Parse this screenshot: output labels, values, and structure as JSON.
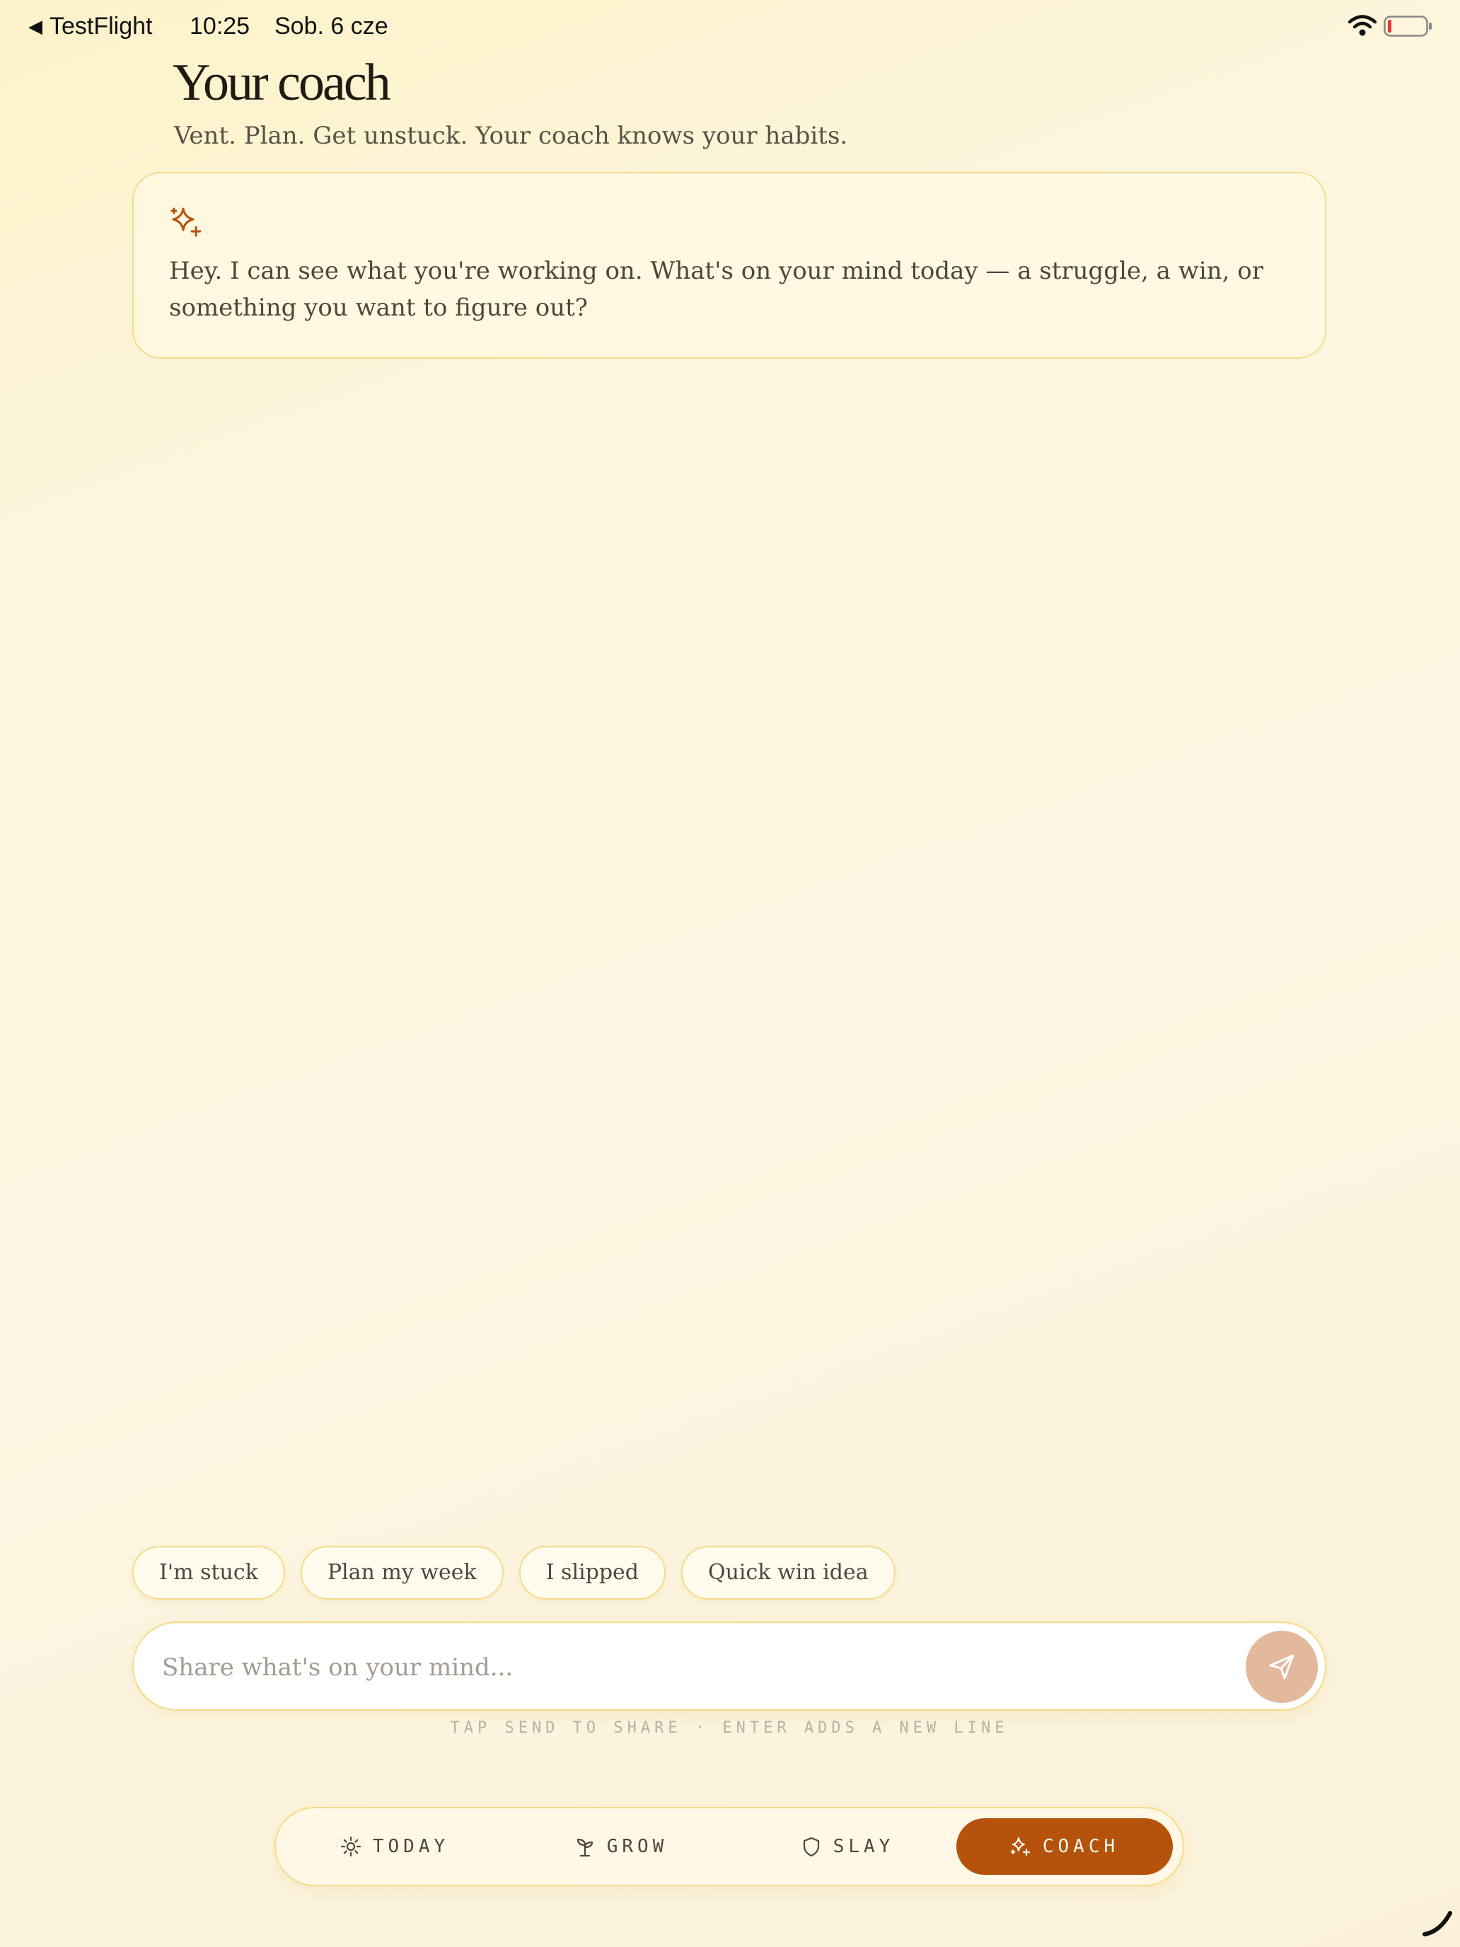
{
  "status_bar": {
    "back_app": "TestFlight",
    "time": "10:25",
    "date": "Sob. 6 cze",
    "icons": [
      "back-triangle-icon",
      "wifi-icon",
      "battery-low-icon"
    ]
  },
  "header": {
    "title": "Your coach",
    "subtitle": "Vent. Plan. Get unstuck. Your coach knows your habits."
  },
  "coach_card": {
    "icon": "sparkle-icon",
    "message": "Hey. I can see what you're working on. What's on your mind today — a struggle, a win, or something you want to figure out?"
  },
  "quick_replies": [
    "I'm stuck",
    "Plan my week",
    "I slipped",
    "Quick win idea"
  ],
  "composer": {
    "placeholder": "Share what's on your mind...",
    "value": "",
    "send_icon": "send-icon",
    "hint": "TAP SEND TO SHARE · ENTER ADDS A NEW LINE"
  },
  "nav": {
    "items": [
      {
        "label": "TODAY",
        "icon": "sun-icon",
        "active": false
      },
      {
        "label": "GROW",
        "icon": "sprout-icon",
        "active": false
      },
      {
        "label": "SLAY",
        "icon": "shield-icon",
        "active": false
      },
      {
        "label": "COACH",
        "icon": "sparkle-icon",
        "active": true
      }
    ]
  },
  "colors": {
    "accent": "#b5530c",
    "card_border": "#f5dc8c",
    "send_button": "#e2b99d",
    "background": "#fcf6e2"
  }
}
